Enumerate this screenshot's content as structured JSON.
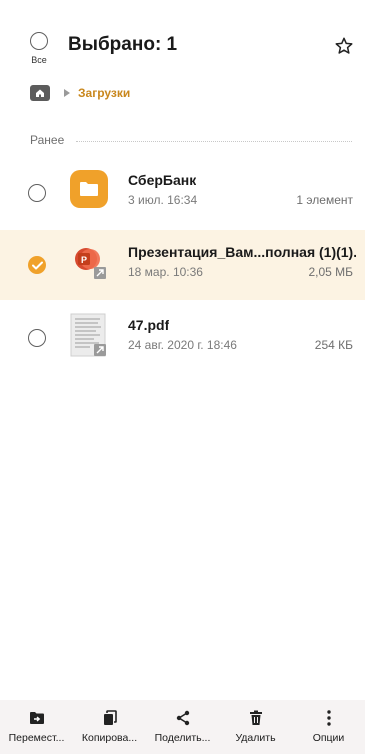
{
  "header": {
    "select_all_label": "Все",
    "title": "Выбрано: 1"
  },
  "breadcrumb": {
    "current": "Загрузки"
  },
  "section": {
    "label": "Ранее"
  },
  "files": [
    {
      "name": "СберБанк",
      "date": "3 июл. 16:34",
      "meta": "1 элемент",
      "type": "folder",
      "selected": false
    },
    {
      "name": "Презентация_Вам...полная (1)(1).",
      "date": "18 мар. 10:36",
      "meta": "2,05 МБ",
      "type": "pptx",
      "selected": true
    },
    {
      "name": "47.pdf",
      "date": "24 авг. 2020 г. 18:46",
      "meta": "254 КБ",
      "type": "pdf",
      "selected": false
    }
  ],
  "bottom_bar": {
    "move": "Перемест...",
    "copy": "Копирова...",
    "share": "Поделить...",
    "delete": "Удалить",
    "options": "Опции"
  },
  "colors": {
    "accent": "#f0a12a",
    "crumb": "#c9871d",
    "selected_row_bg": "#fcf3e3",
    "bottom_bar_bg": "#f6f3f3"
  }
}
